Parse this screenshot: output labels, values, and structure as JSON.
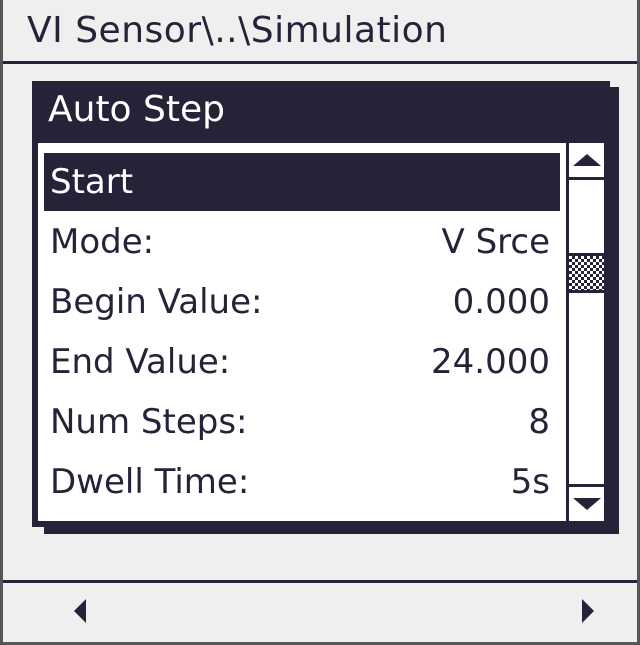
{
  "header": {
    "path": "VI Sensor\\..\\Simulation"
  },
  "dialog": {
    "title": "Auto Step",
    "items": [
      {
        "label": "Start",
        "value": "",
        "selected": true
      },
      {
        "label": "Mode:",
        "value": "V Srce",
        "selected": false
      },
      {
        "label": "Begin Value:",
        "value": "0.000",
        "selected": false
      },
      {
        "label": "End Value:",
        "value": "24.000",
        "selected": false
      },
      {
        "label": "Num Steps:",
        "value": "8",
        "selected": false
      },
      {
        "label": "Dwell Time:",
        "value": "5s",
        "selected": false
      }
    ],
    "scrollbar": {
      "up_icon": "triangle-up-icon",
      "down_icon": "triangle-down-icon",
      "thumb_position": 0.42
    }
  },
  "footer": {
    "left_icon": "triangle-left-icon",
    "right_icon": "triangle-right-icon"
  },
  "colors": {
    "ink": "#262238",
    "background": "#efefef",
    "panel": "#ffffff"
  }
}
